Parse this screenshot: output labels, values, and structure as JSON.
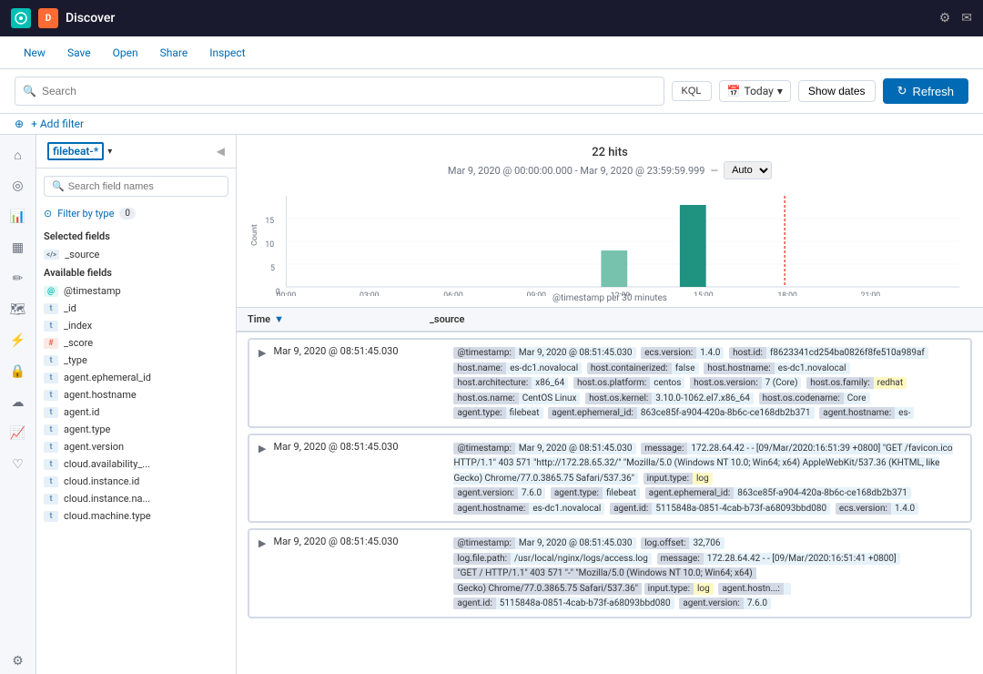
{
  "app": {
    "logo_text": "E",
    "app_icon_text": "D",
    "title": "Discover",
    "top_icons": [
      "settings-icon",
      "mail-icon"
    ]
  },
  "nav": {
    "items": [
      "New",
      "Save",
      "Open",
      "Share",
      "Inspect"
    ]
  },
  "search": {
    "placeholder": "Search",
    "kql_label": "KQL",
    "date_icon": "calendar",
    "date_value": "Today",
    "show_dates_label": "Show dates",
    "refresh_label": "Refresh"
  },
  "filter": {
    "add_filter_label": "+ Add filter"
  },
  "sidebar": {
    "index_pattern": "filebeat-*",
    "search_placeholder": "Search field names",
    "filter_by_type_label": "Filter by type",
    "filter_count": "0",
    "selected_section": "Selected fields",
    "selected_fields": [
      {
        "type": "</>",
        "name": "_source"
      }
    ],
    "available_section": "Available fields",
    "available_fields": [
      {
        "type": "@",
        "name": "@timestamp"
      },
      {
        "type": "t",
        "name": "_id"
      },
      {
        "type": "t",
        "name": "_index"
      },
      {
        "type": "#",
        "name": "_score"
      },
      {
        "type": "t",
        "name": "_type"
      },
      {
        "type": "t",
        "name": "agent.ephemeral_id"
      },
      {
        "type": "t",
        "name": "agent.hostname"
      },
      {
        "type": "t",
        "name": "agent.id"
      },
      {
        "type": "t",
        "name": "agent.type"
      },
      {
        "type": "t",
        "name": "agent.version"
      },
      {
        "type": "t",
        "name": "cloud.availability_..."
      },
      {
        "type": "t",
        "name": "cloud.instance.id"
      },
      {
        "type": "t",
        "name": "cloud.instance.na..."
      },
      {
        "type": "t",
        "name": "cloud.machine.type"
      }
    ]
  },
  "chart": {
    "hits_label": "22 hits",
    "date_range": "Mar 9, 2020 @ 00:00:00.000 - Mar 9, 2020 @ 23:59:59.999",
    "dash": "—",
    "auto_label": "Auto",
    "x_label": "@timestamp per 30 minutes",
    "y_label": "Count",
    "x_ticks": [
      "00:00",
      "03:00",
      "06:00",
      "09:00",
      "12:00",
      "15:00",
      "18:00",
      "21:00"
    ],
    "y_ticks": [
      "0",
      "5",
      "10",
      "15"
    ],
    "bars": [
      {
        "x": 0.48,
        "height": 0.45,
        "highlight": false
      },
      {
        "x": 0.59,
        "height": 0.9,
        "highlight": true
      }
    ]
  },
  "results": {
    "time_header": "Time",
    "source_header": "_source",
    "rows": [
      {
        "time": "Mar 9, 2020 @ 08:51:45.030",
        "fields": [
          {
            "key": "@timestamp:",
            "value": "Mar 9, 2020 @ 08:51:45.030"
          },
          {
            "key": "ecs.version:",
            "value": "1.4.0"
          },
          {
            "key": "host.id:",
            "value": "f8623341cd254ba0826f8fe510a989af"
          },
          {
            "key": "host.name:",
            "value": "es-dc1.novalocal"
          },
          {
            "key": "host.containerized:",
            "value": "false"
          },
          {
            "key": "host.hostname:",
            "value": "es-dc1.novalocal"
          },
          {
            "key": "host.architecture:",
            "value": "x86_64"
          },
          {
            "key": "host.os.platform:",
            "value": "centos"
          },
          {
            "key": "host.os.version:",
            "value": "7 (Core)"
          },
          {
            "key": "host.os.family:",
            "value": "redhat"
          },
          {
            "key": "host.os.name:",
            "value": "CentOS Linux"
          },
          {
            "key": "host.os.kernel:",
            "value": "3.10.0-1062.el7.x86_64"
          },
          {
            "key": "host.os.codename:",
            "value": "Core"
          },
          {
            "key": "agent.type:",
            "value": "filebeat"
          },
          {
            "key": "agent.ephemeral_id:",
            "value": "863ce85f-a904-420a-8b6c-ce168db2b371"
          },
          {
            "key": "agent.hostname:",
            "value": "es-"
          }
        ]
      },
      {
        "time": "Mar 9, 2020 @ 08:51:45.030",
        "fields": [
          {
            "key": "@timestamp:",
            "value": "Mar 9, 2020 @ 08:51:45.030"
          },
          {
            "key": "message:",
            "value": "172.28.64.42 - - [09/Mar/2020:16:51:39 +0800] \"GET /favicon.ico HTTP/1.1\" 403 571 \"http://172.28.65.32/\" \"Mozilla/5.0 (Windows NT 10.0; Win64; x64) AppleWebKit/537.36 (KHTML, like Gecko) Chrome/77.0.3865.75 Safari/537.36\""
          },
          {
            "key": "input.type:",
            "value": "log",
            "highlight": true
          },
          {
            "key": "agent.version:",
            "value": "7.6.0"
          },
          {
            "key": "agent.type:",
            "value": "filebeat"
          },
          {
            "key": "agent.ephemeral_id:",
            "value": "863ce85f-a904-420a-8b6c-ce168db2b371"
          },
          {
            "key": "agent.hostname:",
            "value": "es-dc1.novalocal"
          },
          {
            "key": "agent.id:",
            "value": "5115848a-0851-4cab-b73f-a68093bbd080"
          },
          {
            "key": "ecs.version:",
            "value": "1.4.0"
          }
        ]
      },
      {
        "time": "Mar 9, 2020 @ 08:51:45.030",
        "fields": [
          {
            "key": "@timestamp:",
            "value": "Mar 9, 2020 @ 08:51:45.030"
          },
          {
            "key": "log.offset:",
            "value": "32,706"
          },
          {
            "key": "log.file.path:",
            "value": "/usr/local/nginx/logs/access.log"
          },
          {
            "key": "message:",
            "value": "172.28.64.42 - - [09/Mar/2020:16:51:41 +0800] \"GET / HTTP/1.1\" 403 571 \"-\" \"Mozilla/5.0 (Windows NT 10.0; Win64; x64) Gecko) Chrome/77.0.3865.75 Safari/537.36\""
          },
          {
            "key": "input.type:",
            "value": "log",
            "highlight": true
          },
          {
            "key": "agent.hostn...",
            "value": ""
          },
          {
            "key": "agent.id:",
            "value": "5115848a-0851-4cab-b73f-a68093bbd080"
          },
          {
            "key": "agent.version:",
            "value": "7.6.0"
          }
        ]
      }
    ]
  }
}
